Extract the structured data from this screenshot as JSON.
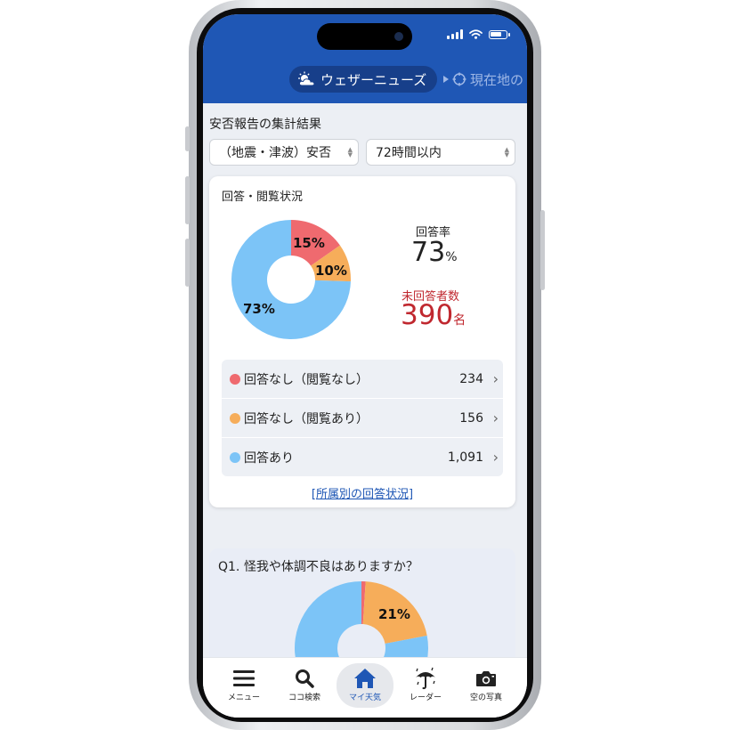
{
  "header": {
    "active_tab": "ウェザーニューズ",
    "next_tab": "現在地の"
  },
  "section": {
    "title": "安否報告の集計結果",
    "filter_type": "（地震・津波）安否",
    "filter_time": "72時間以内"
  },
  "status_card": {
    "title": "回答・閲覧状況",
    "pie": {
      "no_answer_not_viewed_pct": "15%",
      "no_answer_viewed_pct": "10%",
      "answered_pct": "73%"
    },
    "answer_rate_label": "回答率",
    "answer_rate_value": "73",
    "answer_rate_unit": "%",
    "unanswered_label": "未回答者数",
    "unanswered_value": "390",
    "unanswered_unit": "名",
    "rows": [
      {
        "label": "回答なし（閲覧なし）",
        "count": "234",
        "color": "#ef6a6f"
      },
      {
        "label": "回答なし（閲覧あり）",
        "count": "156",
        "color": "#f6ad5a"
      },
      {
        "label": "回答あり",
        "count": "1,091",
        "color": "#7cc4f7"
      }
    ],
    "link": "[所属別の回答状況]"
  },
  "question_card": {
    "title": "Q1. 怪我や体調不良はありますか？",
    "pie_label": "21%"
  },
  "chart_data": [
    {
      "type": "pie",
      "title": "回答・閲覧状況",
      "categories": [
        "回答なし（閲覧なし）",
        "回答なし（閲覧あり）",
        "回答あり"
      ],
      "values": [
        15,
        10,
        73
      ],
      "colors": [
        "#ef6a6f",
        "#f6ad5a",
        "#7cc4f7"
      ]
    },
    {
      "type": "pie",
      "title": "Q1. 怪我や体調不良はありますか？",
      "values": [
        1,
        21,
        78
      ],
      "colors": [
        "#ef6a6f",
        "#f6ad5a",
        "#7cc4f7"
      ]
    }
  ],
  "nav": {
    "menu": "メニュー",
    "search": "ココ検索",
    "my_weather": "マイ天気",
    "radar": "レーダー",
    "sky_photo": "空の写真"
  },
  "colors": {
    "brand": "#1f57b5",
    "alert": "#c0282f"
  }
}
